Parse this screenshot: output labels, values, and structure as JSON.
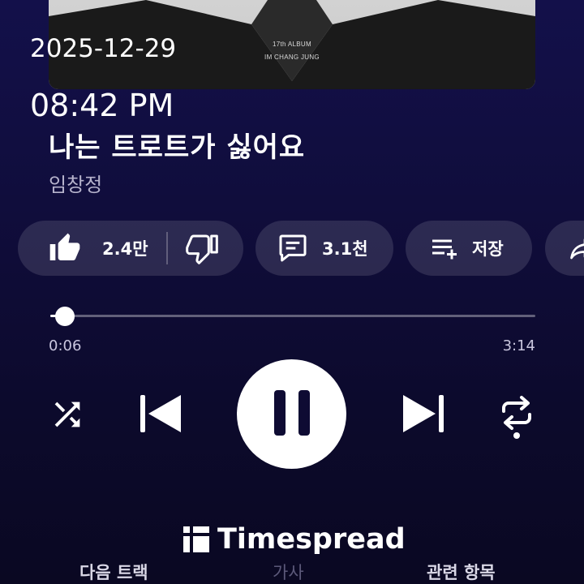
{
  "album": {
    "line1": "17th ALBUM",
    "line2": "IM CHANG JUNG"
  },
  "overlay": {
    "date": "2025-12-29",
    "time": "08:42 PM"
  },
  "song": {
    "title": "나는 트로트가 싫어요",
    "artist": "임창정"
  },
  "actions": {
    "like_count": "2.4만",
    "comment_count": "3.1천",
    "save_label": "저장"
  },
  "progress": {
    "elapsed": "0:06",
    "total": "3:14",
    "fraction": 0.03
  },
  "watermark": "Timespread",
  "tabs": {
    "next": "다음 트랙",
    "lyrics": "가사",
    "related": "관련 항목"
  },
  "icons": {
    "like": "thumbs-up-icon",
    "dislike": "thumbs-down-icon",
    "comment": "comment-icon",
    "save": "playlist-add-icon",
    "share": "share-icon",
    "shuffle": "shuffle-icon",
    "previous": "skip-previous-icon",
    "pause": "pause-icon",
    "next": "skip-next-icon",
    "repeat": "repeat-icon"
  }
}
